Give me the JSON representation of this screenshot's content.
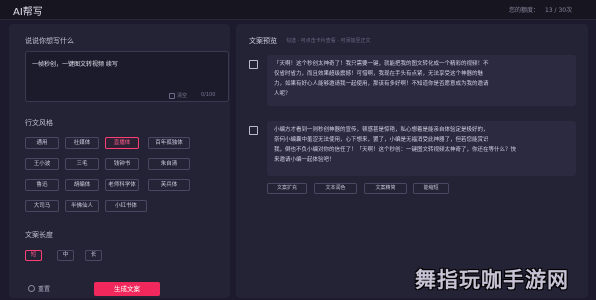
{
  "app": {
    "title": "AI帮写",
    "quota_label": "您的额度：",
    "quota_value": "13 / 30次"
  },
  "input": {
    "label": "说说你想写什么",
    "value": "一帧秒创，一键图文转视频 续写",
    "clear_label": "清空",
    "char_count": "0/100"
  },
  "style": {
    "label": "行文风格",
    "selected": "直播体",
    "options": [
      [
        "通用",
        "社媒体",
        "直播体",
        "百年孤独体"
      ],
      [
        "王小波",
        "三毛",
        "钱钟书",
        "朱自清"
      ],
      [
        "鲁迅",
        "胡编体",
        "老师科学体",
        "芙兵体"
      ],
      [
        "大司马",
        "半佛仙人",
        "小红书体"
      ]
    ]
  },
  "length": {
    "label": "文案长度",
    "options": [
      "短",
      "中",
      "长"
    ],
    "selected": "短"
  },
  "footer": {
    "reset_label": "重置",
    "generate_label": "生成文案"
  },
  "preview": {
    "title": "文案预览",
    "hint": "勾选 · 可点击卡片查看 · 可添加至正文",
    "results": [
      [
        "「天啊！这个秒创太神奇了！我只需要一键，就能把我的图文转化成一个精彩的视频！不",
        "仅省时省力，而且效果超级震撼！可惜啊，我现在手头有点紧，无法享受这个神器的魅",
        "力，如果有好心人能够邀请我一起使用，那该有多好啊！不知道你是否愿意成为我的邀请",
        "人呢？"
      ],
      [
        "小编方才看到一则秒创神器的宣传，顿感甚是惊艳，私心想着是能亲自体验定是极好的，",
        "奈何小编囊中羞涩无法使用，心下想来，罢了，小编是无福消受此神器了，但若您能赏识",
        "我，倒也不负小编对你的信任了！「天啊！这个秒创：一键图文转视频太神奇了，你还在等什么？快",
        "来邀请小编一起体验吧！"
      ]
    ],
    "actions": [
      "文案扩充",
      "文本润色",
      "文案精简",
      "能缩短"
    ]
  },
  "watermark": "舞指玩咖手游网"
}
